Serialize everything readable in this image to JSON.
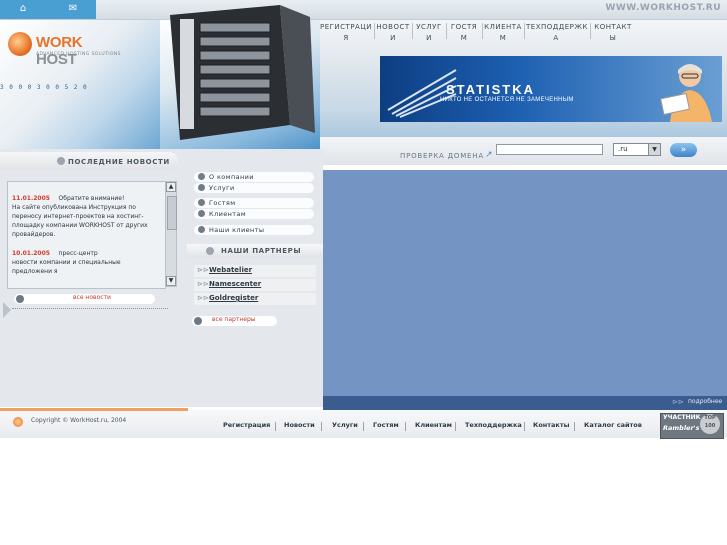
{
  "header": {
    "site_url": "WWW.WORKHOST.RU",
    "logo_main": "WORK",
    "logo_second": "HOST",
    "logo_tagline": "ADVANCED HOSTING SOLUTIONS",
    "digits": "3 0 0 0 3 0 0 5 2 0"
  },
  "nav": {
    "items": [
      {
        "label": "РЕГИСТРАЦИ",
        "label2": "Я"
      },
      {
        "label": "НОВОСТ",
        "label2": "И"
      },
      {
        "label": "УСЛУГ",
        "label2": "И"
      },
      {
        "label": "ГОСТЯ",
        "label2": "М"
      },
      {
        "label": "КЛИЕНТА",
        "label2": "М"
      },
      {
        "label": "ТЕХПОДДЕРЖК",
        "label2": "А"
      },
      {
        "label": "КОНТАКТ",
        "label2": "Ы"
      }
    ]
  },
  "banner": {
    "title": "STATISTKA",
    "subtitle": "НИКТО НЕ ОСТАНЕТСЯ НЕ ЗАМЕЧЕННЫМ"
  },
  "domain": {
    "label": "ПРОВЕРКА ДОМЕНА",
    "input_value": "",
    "zone": ".ru",
    "go": "»"
  },
  "news": {
    "heading": "ПОСЛЕДНИЕ НОВОСТИ",
    "items": [
      {
        "date": "11.01.2005",
        "title": "Обратите внимание!",
        "body": "На сайте опубликована Инструкция по переносу интернет-проектов на хостинг-площадку компании WORKHOST от других провайдеров."
      },
      {
        "date": "10.01.2005",
        "title": "пресс-центр",
        "body": "новости компании и специальные предложени я"
      }
    ],
    "all_link": "все новости"
  },
  "menu": {
    "items": [
      "О компании",
      "Услуги",
      "Гостям",
      "Клиентам",
      "Наши клиенты"
    ]
  },
  "partners": {
    "heading": "НАШИ ПАРТНЕРЫ",
    "items": [
      "Webatelier",
      "Namescenter",
      "Goldregister"
    ],
    "all_link": "все партнеры"
  },
  "main": {
    "more_link": "подробнее"
  },
  "footer": {
    "copyright": "Copyright © WorkHost.ru, 2004",
    "nav": [
      "Регистрация",
      "Новости",
      "Услуги",
      "Гостям",
      "Клиентам",
      "Техподдержка",
      "Контакты",
      "Каталог сайтов"
    ],
    "rambler_line1": "УЧАСТНИК",
    "rambler_line2": "Rambler's",
    "rambler_top": "TOP 100"
  }
}
